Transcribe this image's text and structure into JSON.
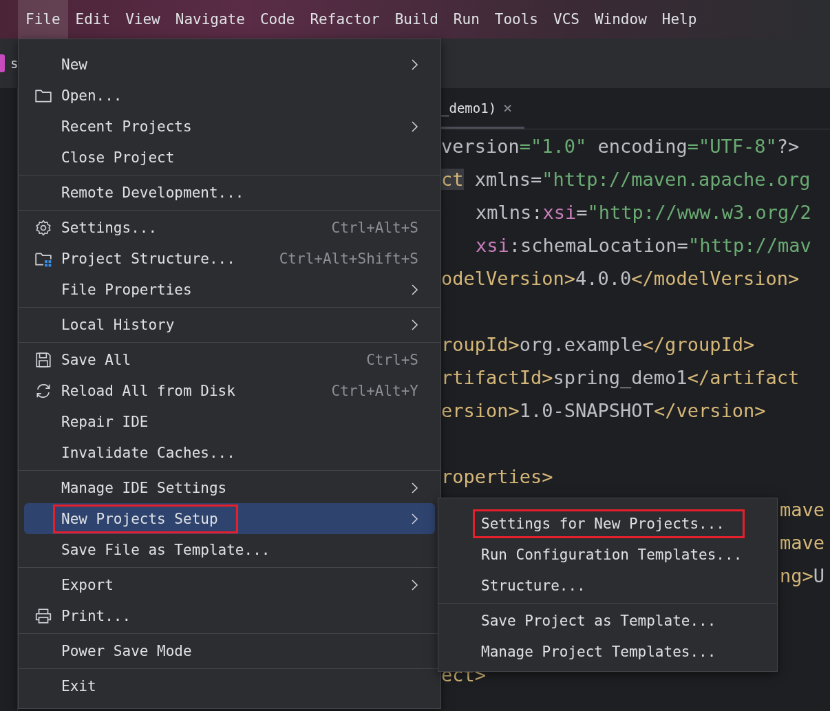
{
  "menubar": [
    {
      "label": "File",
      "selected": true
    },
    {
      "label": "Edit",
      "selected": false
    },
    {
      "label": "View",
      "selected": false
    },
    {
      "label": "Navigate",
      "selected": false
    },
    {
      "label": "Code",
      "selected": false
    },
    {
      "label": "Refactor",
      "selected": false
    },
    {
      "label": "Build",
      "selected": false
    },
    {
      "label": "Run",
      "selected": false
    },
    {
      "label": "Tools",
      "selected": false
    },
    {
      "label": "VCS",
      "selected": false
    },
    {
      "label": "Window",
      "selected": false
    },
    {
      "label": "Help",
      "selected": false
    }
  ],
  "side_tab": {
    "label": "s"
  },
  "editor_tab": {
    "label": "_demo1)",
    "close": "×"
  },
  "code_lines": [
    {
      "kind": "line",
      "tokens": [
        {
          "kind": "attr",
          "text": "version"
        },
        {
          "kind": "string",
          "text": "=\"1.0\""
        },
        {
          "kind": "attr",
          "text": " encoding"
        },
        {
          "kind": "string",
          "text": "=\"UTF-8\""
        },
        {
          "kind": "attr",
          "text": "?>"
        }
      ]
    },
    {
      "kind": "line",
      "tokens": [
        {
          "kind": "tag-hl",
          "text": "ct"
        },
        {
          "kind": "attr",
          "text": " xmlns="
        },
        {
          "kind": "string",
          "text": "\"http://maven.apache.org"
        }
      ]
    },
    {
      "kind": "indent",
      "tokens": [
        {
          "kind": "attr",
          "text": "xmlns:"
        },
        {
          "kind": "ns",
          "text": "xsi"
        },
        {
          "kind": "attr",
          "text": "="
        },
        {
          "kind": "string",
          "text": "\"http://www.w3.org/2"
        }
      ]
    },
    {
      "kind": "indent",
      "tokens": [
        {
          "kind": "ns",
          "text": "xsi"
        },
        {
          "kind": "attr",
          "text": ":schemaLocation="
        },
        {
          "kind": "string",
          "text": "\"http://mav"
        }
      ]
    },
    {
      "kind": "line",
      "tokens": [
        {
          "kind": "tag",
          "text": "odelVersion>"
        },
        {
          "kind": "attr",
          "text": "4.0.0"
        },
        {
          "kind": "tag",
          "text": "</modelVersion>"
        }
      ]
    },
    {
      "kind": "blank"
    },
    {
      "kind": "line",
      "tokens": [
        {
          "kind": "tag",
          "text": "roupId>"
        },
        {
          "kind": "attr",
          "text": "org.example"
        },
        {
          "kind": "tag",
          "text": "</groupId>"
        }
      ]
    },
    {
      "kind": "line",
      "tokens": [
        {
          "kind": "tag",
          "text": "rtifactId>"
        },
        {
          "kind": "attr",
          "text": "spring_demo1"
        },
        {
          "kind": "tag",
          "text": "</artifact"
        }
      ]
    },
    {
      "kind": "line",
      "tokens": [
        {
          "kind": "tag",
          "text": "ersion>"
        },
        {
          "kind": "attr",
          "text": "1.0-SNAPSHOT"
        },
        {
          "kind": "tag",
          "text": "</version>"
        }
      ]
    },
    {
      "kind": "blank"
    },
    {
      "kind": "line",
      "tokens": [
        {
          "kind": "tag",
          "text": "roperties>"
        }
      ]
    },
    {
      "kind": "covered",
      "tokens": [
        {
          "kind": "tag",
          "text": "mave"
        }
      ]
    },
    {
      "kind": "covered",
      "tokens": [
        {
          "kind": "tag",
          "text": "mave"
        }
      ]
    },
    {
      "kind": "covered",
      "tokens": [
        {
          "kind": "tag",
          "text": "ng>"
        },
        {
          "kind": "attr",
          "text": "U"
        }
      ]
    },
    {
      "kind": "blank"
    },
    {
      "kind": "blank"
    },
    {
      "kind": "line",
      "tokens": [
        {
          "kind": "tag",
          "text": "ect>"
        }
      ]
    }
  ],
  "file_menu": [
    {
      "kind": "item",
      "label": "New",
      "submenu": true,
      "selected": false
    },
    {
      "kind": "folder",
      "label": "Open...",
      "selected": false
    },
    {
      "kind": "item",
      "label": "Recent Projects",
      "submenu": true,
      "selected": false
    },
    {
      "kind": "item",
      "label": "Close Project",
      "selected": false
    },
    {
      "kind": "separator"
    },
    {
      "kind": "item",
      "label": "Remote Development...",
      "selected": false
    },
    {
      "kind": "separator"
    },
    {
      "kind": "gear",
      "label": "Settings...",
      "shortcut": "Ctrl+Alt+S",
      "selected": false
    },
    {
      "kind": "structure",
      "label": "Project Structure...",
      "shortcut": "Ctrl+Alt+Shift+S",
      "selected": false
    },
    {
      "kind": "item",
      "label": "File Properties",
      "submenu": true,
      "selected": false
    },
    {
      "kind": "separator"
    },
    {
      "kind": "item",
      "label": "Local History",
      "submenu": true,
      "selected": false
    },
    {
      "kind": "separator"
    },
    {
      "kind": "save",
      "label": "Save All",
      "shortcut": "Ctrl+S",
      "selected": false
    },
    {
      "kind": "reload",
      "label": "Reload All from Disk",
      "shortcut": "Ctrl+Alt+Y",
      "selected": false
    },
    {
      "kind": "item",
      "label": "Repair IDE",
      "selected": false
    },
    {
      "kind": "item",
      "label": "Invalidate Caches...",
      "selected": false
    },
    {
      "kind": "separator"
    },
    {
      "kind": "item",
      "label": "Manage IDE Settings",
      "submenu": true,
      "selected": false
    },
    {
      "kind": "item",
      "label": "New Projects Setup",
      "submenu": true,
      "selected": true,
      "highlighted": true
    },
    {
      "kind": "item",
      "label": "Save File as Template...",
      "selected": false
    },
    {
      "kind": "separator"
    },
    {
      "kind": "item",
      "label": "Export",
      "submenu": true,
      "selected": false
    },
    {
      "kind": "printer",
      "label": "Print...",
      "selected": false
    },
    {
      "kind": "separator"
    },
    {
      "kind": "item",
      "label": "Power Save Mode",
      "selected": false
    },
    {
      "kind": "separator"
    },
    {
      "kind": "item",
      "label": "Exit",
      "selected": false
    }
  ],
  "sub_menu": [
    {
      "kind": "item",
      "label": "Settings for New Projects...",
      "selected": false,
      "highlighted": true
    },
    {
      "kind": "item",
      "label": "Run Configuration Templates...",
      "selected": false
    },
    {
      "kind": "item",
      "label": "Structure...",
      "selected": false
    },
    {
      "kind": "separator"
    },
    {
      "kind": "item",
      "label": "Save Project as Template...",
      "selected": false
    },
    {
      "kind": "item",
      "label": "Manage Project Templates...",
      "selected": false
    }
  ]
}
